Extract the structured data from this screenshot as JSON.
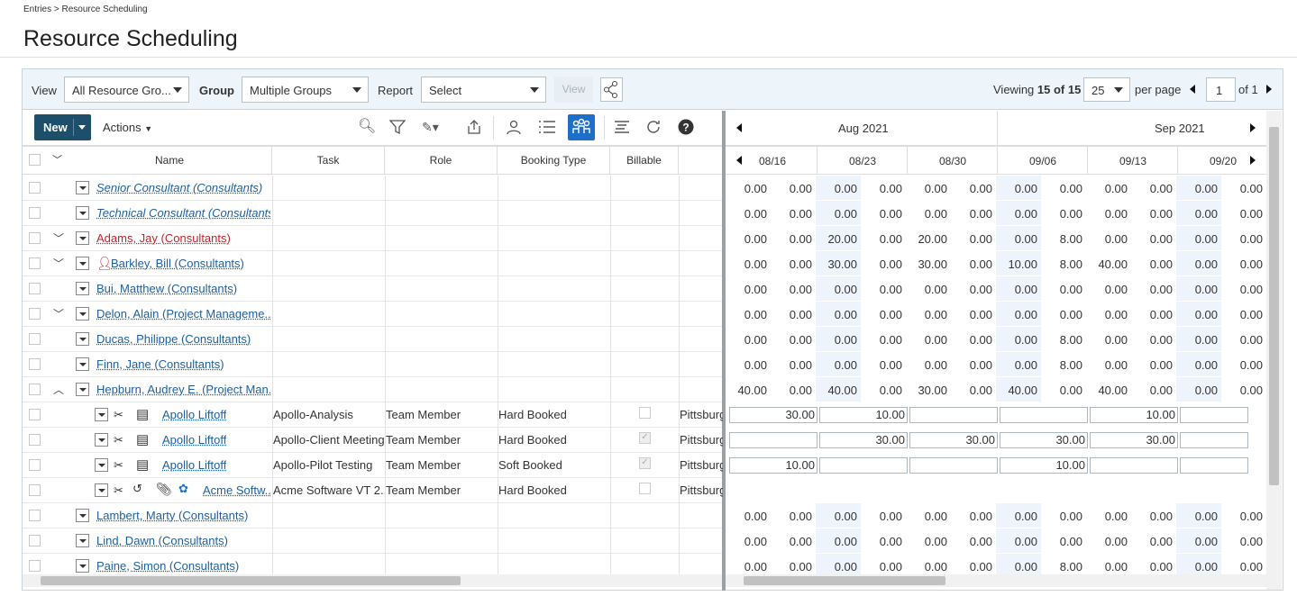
{
  "breadcrumb": "Entries > Resource Scheduling",
  "page_title": "Resource Scheduling",
  "toolbar": {
    "view_label": "View",
    "view_value": "All Resource Gro...",
    "group_label": "Group",
    "group_value": "Multiple Groups",
    "report_label": "Report",
    "report_value": "Select",
    "view_button": "View",
    "viewing_prefix": "Viewing ",
    "viewing_count": "15 of 15",
    "per_page_value": "25",
    "per_page_label": "per page",
    "page_value": "1",
    "of_pages": "of 1"
  },
  "grid_toolbar": {
    "new_label": "New",
    "actions_label": "Actions"
  },
  "columns": [
    "Name",
    "Task",
    "Role",
    "Booking Type",
    "Billable"
  ],
  "months": [
    "Aug 2021",
    "Sep 2021"
  ],
  "weeks": [
    "08/16",
    "08/23",
    "08/30",
    "09/06",
    "09/13",
    "09/20"
  ],
  "rows": [
    {
      "name": "Senior Consultant (Consultants)",
      "style": "it",
      "chev": "",
      "nums": [
        "0.00",
        "0.00",
        "0.00",
        "0.00",
        "0.00",
        "0.00",
        "0.00",
        "0.00",
        "0.00",
        "0.00",
        "0.00",
        "0.00"
      ]
    },
    {
      "name": "Technical Consultant (Consultants)",
      "style": "it",
      "chev": "",
      "nums": [
        "0.00",
        "0.00",
        "0.00",
        "0.00",
        "0.00",
        "0.00",
        "0.00",
        "0.00",
        "0.00",
        "0.00",
        "0.00",
        "0.00"
      ]
    },
    {
      "name": "Adams, Jay (Consultants)",
      "style": "red",
      "chev": "﹀",
      "nums": [
        "0.00",
        "0.00",
        "20.00",
        "0.00",
        "20.00",
        "0.00",
        "0.00",
        "8.00",
        "0.00",
        "0.00",
        "0.00",
        "0.00"
      ]
    },
    {
      "name": "Barkley, Bill (Consultants)",
      "style": "",
      "chev": "﹀",
      "person": true,
      "nums": [
        "0.00",
        "0.00",
        "30.00",
        "0.00",
        "30.00",
        "0.00",
        "10.00",
        "8.00",
        "40.00",
        "0.00",
        "0.00",
        "0.00"
      ]
    },
    {
      "name": "Bui, Matthew (Consultants)",
      "style": "",
      "chev": "",
      "nums": [
        "0.00",
        "0.00",
        "0.00",
        "0.00",
        "0.00",
        "0.00",
        "0.00",
        "0.00",
        "0.00",
        "0.00",
        "0.00",
        "0.00"
      ]
    },
    {
      "name": "Delon, Alain (Project Manageme...",
      "style": "",
      "chev": "﹀",
      "nums": [
        "0.00",
        "0.00",
        "0.00",
        "0.00",
        "0.00",
        "0.00",
        "0.00",
        "0.00",
        "0.00",
        "0.00",
        "0.00",
        "0.00"
      ]
    },
    {
      "name": "Ducas, Philippe (Consultants)",
      "style": "",
      "chev": "",
      "nums": [
        "0.00",
        "0.00",
        "0.00",
        "0.00",
        "0.00",
        "0.00",
        "0.00",
        "8.00",
        "0.00",
        "0.00",
        "0.00",
        "0.00"
      ]
    },
    {
      "name": "Finn, Jane (Consultants)",
      "style": "",
      "chev": "",
      "nums": [
        "0.00",
        "0.00",
        "0.00",
        "0.00",
        "0.00",
        "0.00",
        "0.00",
        "8.00",
        "0.00",
        "0.00",
        "0.00",
        "0.00"
      ]
    },
    {
      "name": "Hepburn, Audrey E. (Project Man...",
      "style": "",
      "chev": "︿",
      "nums": [
        "40.00",
        "0.00",
        "40.00",
        "0.00",
        "30.00",
        "0.00",
        "40.00",
        "0.00",
        "40.00",
        "0.00",
        "0.00",
        "0.00"
      ]
    }
  ],
  "sub_rows": [
    {
      "name": "Apollo Liftoff",
      "task": "Apollo-Analysis",
      "role": "Team Member",
      "booking": "Hard Booked",
      "billable": false,
      "loc": "Pittsburg",
      "boxes": [
        "30.00",
        "10.00",
        "",
        "",
        "10.00",
        ""
      ]
    },
    {
      "name": "Apollo Liftoff",
      "task": "Apollo-Client Meeting",
      "role": "Team Member",
      "booking": "Hard Booked",
      "billable": true,
      "loc": "Pittsburg",
      "boxes": [
        "",
        "30.00",
        "30.00",
        "30.00",
        "30.00",
        ""
      ]
    },
    {
      "name": "Apollo Liftoff",
      "task": "Apollo-Pilot Testing",
      "role": "Team Member",
      "booking": "Soft Booked",
      "billable": true,
      "loc": "Pittsburg",
      "boxes": [
        "10.00",
        "",
        "",
        "10.00",
        "",
        ""
      ]
    },
    {
      "name": "Acme Softw...",
      "task": "Acme Software VT 2...",
      "role": "Team Member",
      "booking": "Hard Booked",
      "billable": false,
      "loc": "Pittsburg",
      "boxes": null
    }
  ],
  "bottom_rows": [
    {
      "name": "Lambert, Marty (Consultants)",
      "nums": [
        "0.00",
        "0.00",
        "0.00",
        "0.00",
        "0.00",
        "0.00",
        "0.00",
        "0.00",
        "0.00",
        "0.00",
        "0.00",
        "0.00"
      ]
    },
    {
      "name": "Lind, Dawn (Consultants)",
      "nums": [
        "0.00",
        "0.00",
        "0.00",
        "0.00",
        "0.00",
        "0.00",
        "0.00",
        "0.00",
        "0.00",
        "0.00",
        "0.00",
        "0.00"
      ]
    },
    {
      "name": "Paine, Simon (Consultants)",
      "nums": [
        "0.00",
        "0.00",
        "0.00",
        "0.00",
        "0.00",
        "0.00",
        "0.00",
        "8.00",
        "0.00",
        "0.00",
        "0.00",
        "0.00"
      ]
    }
  ],
  "colors": {
    "accent": "#1d4f6b",
    "link": "#1f5fa0",
    "overallocated": "#c0262c",
    "toolbar_bg": "#edf4fa"
  }
}
